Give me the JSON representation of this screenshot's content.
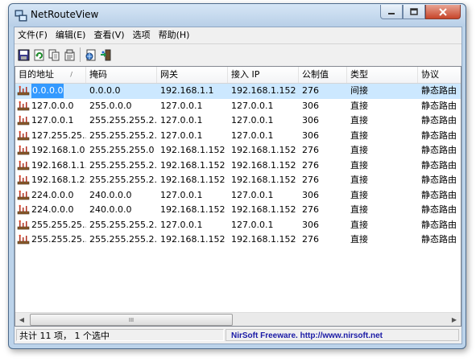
{
  "window": {
    "title": "NetRouteView",
    "controls": [
      "minimize",
      "maximize",
      "close"
    ]
  },
  "menu": [
    "文件(F)",
    "编辑(E)",
    "查看(V)",
    "选项",
    "帮助(H)"
  ],
  "toolbar": {
    "buttons": [
      "save-icon",
      "refresh-icon",
      "copy-icon",
      "properties-icon",
      "html-report-icon",
      "exit-icon"
    ]
  },
  "columns": [
    "目的地址",
    "掩码",
    "网关",
    "接入 IP",
    "公制值",
    "类型",
    "协议"
  ],
  "rows": [
    {
      "dest": "0.0.0.0",
      "mask": "0.0.0.0",
      "gateway": "192.168.1.1",
      "iface": "192.168.1.152",
      "metric": "276",
      "type": "间接",
      "proto": "静态路由"
    },
    {
      "dest": "127.0.0.0",
      "mask": "255.0.0.0",
      "gateway": "127.0.0.1",
      "iface": "127.0.0.1",
      "metric": "306",
      "type": "直接",
      "proto": "静态路由"
    },
    {
      "dest": "127.0.0.1",
      "mask": "255.255.255.2...",
      "gateway": "127.0.0.1",
      "iface": "127.0.0.1",
      "metric": "306",
      "type": "直接",
      "proto": "静态路由"
    },
    {
      "dest": "127.255.25...",
      "mask": "255.255.255.2...",
      "gateway": "127.0.0.1",
      "iface": "127.0.0.1",
      "metric": "306",
      "type": "直接",
      "proto": "静态路由"
    },
    {
      "dest": "192.168.1.0",
      "mask": "255.255.255.0",
      "gateway": "192.168.1.152",
      "iface": "192.168.1.152",
      "metric": "276",
      "type": "直接",
      "proto": "静态路由"
    },
    {
      "dest": "192.168.1.1...",
      "mask": "255.255.255.2...",
      "gateway": "192.168.1.152",
      "iface": "192.168.1.152",
      "metric": "276",
      "type": "直接",
      "proto": "静态路由"
    },
    {
      "dest": "192.168.1.2...",
      "mask": "255.255.255.2...",
      "gateway": "192.168.1.152",
      "iface": "192.168.1.152",
      "metric": "276",
      "type": "直接",
      "proto": "静态路由"
    },
    {
      "dest": "224.0.0.0",
      "mask": "240.0.0.0",
      "gateway": "127.0.0.1",
      "iface": "127.0.0.1",
      "metric": "306",
      "type": "直接",
      "proto": "静态路由"
    },
    {
      "dest": "224.0.0.0",
      "mask": "240.0.0.0",
      "gateway": "192.168.1.152",
      "iface": "192.168.1.152",
      "metric": "276",
      "type": "直接",
      "proto": "静态路由"
    },
    {
      "dest": "255.255.25...",
      "mask": "255.255.255.2...",
      "gateway": "127.0.0.1",
      "iface": "127.0.0.1",
      "metric": "306",
      "type": "直接",
      "proto": "静态路由"
    },
    {
      "dest": "255.255.25...",
      "mask": "255.255.255.2...",
      "gateway": "192.168.1.152",
      "iface": "192.168.1.152",
      "metric": "276",
      "type": "直接",
      "proto": "静态路由"
    }
  ],
  "selected_row": 0,
  "scrollbar": {
    "thumb_grip": "III"
  },
  "status": {
    "summary": "共计 11 项， 1 个选中",
    "credit": "NirSoft Freeware.  http://www.nirsoft.net"
  },
  "colors": {
    "selection": "#3399ff",
    "selection_row": "#cce8ff",
    "credit_text": "#1a1aa6"
  }
}
